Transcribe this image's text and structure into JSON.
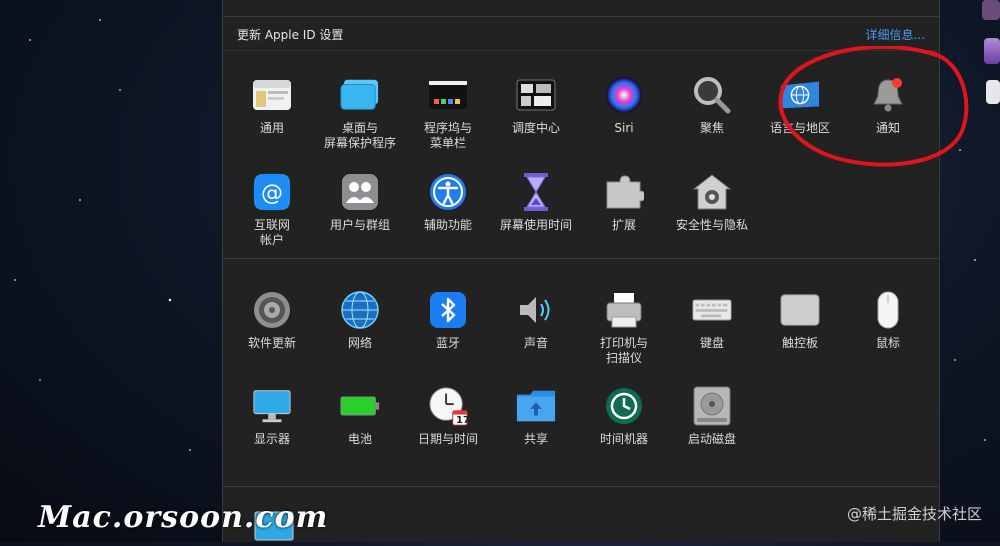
{
  "banner": {
    "text": "更新 Apple ID 设置",
    "link": "详细信息..."
  },
  "section1": {
    "row1": [
      {
        "label": "通用",
        "icon": "general-icon"
      },
      {
        "label": "桌面与\n屏幕保护程序",
        "icon": "desktop-screensaver-icon"
      },
      {
        "label": "程序坞与\n菜单栏",
        "icon": "dock-menubar-icon"
      },
      {
        "label": "调度中心",
        "icon": "mission-control-icon"
      },
      {
        "label": "Siri",
        "icon": "siri-icon"
      },
      {
        "label": "聚焦",
        "icon": "spotlight-icon"
      },
      {
        "label": "语言与地区",
        "icon": "language-region-icon"
      },
      {
        "label": "通知",
        "icon": "notifications-icon"
      }
    ],
    "row2": [
      {
        "label": "互联网\n帐户",
        "icon": "internet-accounts-icon"
      },
      {
        "label": "用户与群组",
        "icon": "users-groups-icon"
      },
      {
        "label": "辅助功能",
        "icon": "accessibility-icon"
      },
      {
        "label": "屏幕使用时间",
        "icon": "screen-time-icon"
      },
      {
        "label": "扩展",
        "icon": "extensions-icon"
      },
      {
        "label": "安全性与隐私",
        "icon": "security-privacy-icon"
      }
    ]
  },
  "section2": {
    "row1": [
      {
        "label": "软件更新",
        "icon": "software-update-icon"
      },
      {
        "label": "网络",
        "icon": "network-icon"
      },
      {
        "label": "蓝牙",
        "icon": "bluetooth-icon"
      },
      {
        "label": "声音",
        "icon": "sound-icon"
      },
      {
        "label": "打印机与\n扫描仪",
        "icon": "printers-scanners-icon"
      },
      {
        "label": "键盘",
        "icon": "keyboard-icon"
      },
      {
        "label": "触控板",
        "icon": "trackpad-icon"
      },
      {
        "label": "鼠标",
        "icon": "mouse-icon"
      }
    ],
    "row2": [
      {
        "label": "显示器",
        "icon": "displays-icon"
      },
      {
        "label": "电池",
        "icon": "battery-icon"
      },
      {
        "label": "日期与时间",
        "icon": "date-time-icon"
      },
      {
        "label": "共享",
        "icon": "sharing-icon"
      },
      {
        "label": "时间机器",
        "icon": "time-machine-icon"
      },
      {
        "label": "启动磁盘",
        "icon": "startup-disk-icon"
      }
    ]
  },
  "date_icon_day": "17",
  "watermark_left": "Mac.orsoon.com",
  "watermark_right": "@稀土掘金技术社区",
  "colors": {
    "panel": "#222223",
    "link": "#4a9cf5",
    "highlight_ring": "#e0141e"
  }
}
